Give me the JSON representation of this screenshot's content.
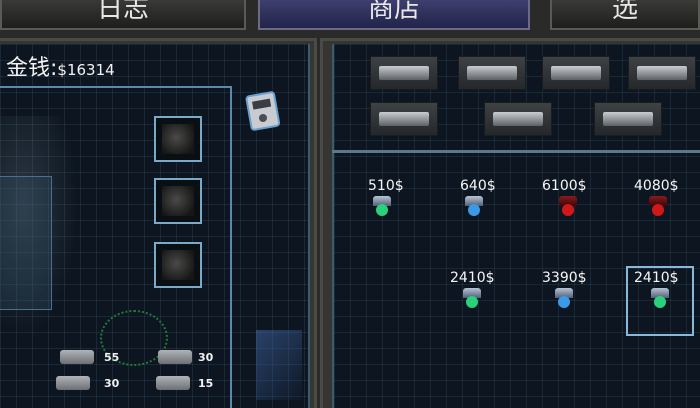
{
  "tabs": [
    {
      "label": "日志",
      "active": false
    },
    {
      "label": "商店",
      "active": true
    },
    {
      "label": "选",
      "active": false
    }
  ],
  "money": {
    "label": "金钱:",
    "value": "$16314"
  },
  "equipment_slots": [
    {
      "name": "slot-1"
    },
    {
      "name": "slot-2"
    },
    {
      "name": "slot-3"
    }
  ],
  "stats": [
    {
      "icon": "heart-armor-icon",
      "value": "55"
    },
    {
      "icon": "vest-icon",
      "value": "30"
    },
    {
      "icon": "rifle-icon",
      "value": "30"
    },
    {
      "icon": "pistol-icon",
      "value": "15"
    }
  ],
  "categories": [
    {
      "icon": "pistol-icon"
    },
    {
      "icon": "shotgun-icon"
    },
    {
      "icon": "rifle-scope-icon"
    },
    {
      "icon": "heavy-gun-icon"
    },
    {
      "icon": "armor-vest-icon"
    },
    {
      "icon": "ammo-box-icon"
    },
    {
      "icon": "medkit-icon"
    }
  ],
  "shop_items": [
    {
      "price": "510$",
      "color": "#2ad07a"
    },
    {
      "price": "640$",
      "color": "#3a9ae8"
    },
    {
      "price": "6100$",
      "color": "#d01818"
    },
    {
      "price": "4080$",
      "color": "#d01818"
    },
    {
      "price": "2410$",
      "color": "#2ad07a"
    },
    {
      "price": "3390$",
      "color": "#3a9ae8"
    },
    {
      "price": "2410$",
      "color": "#2ad07a",
      "selected": true
    }
  ],
  "accent_color": "#7aaac8"
}
